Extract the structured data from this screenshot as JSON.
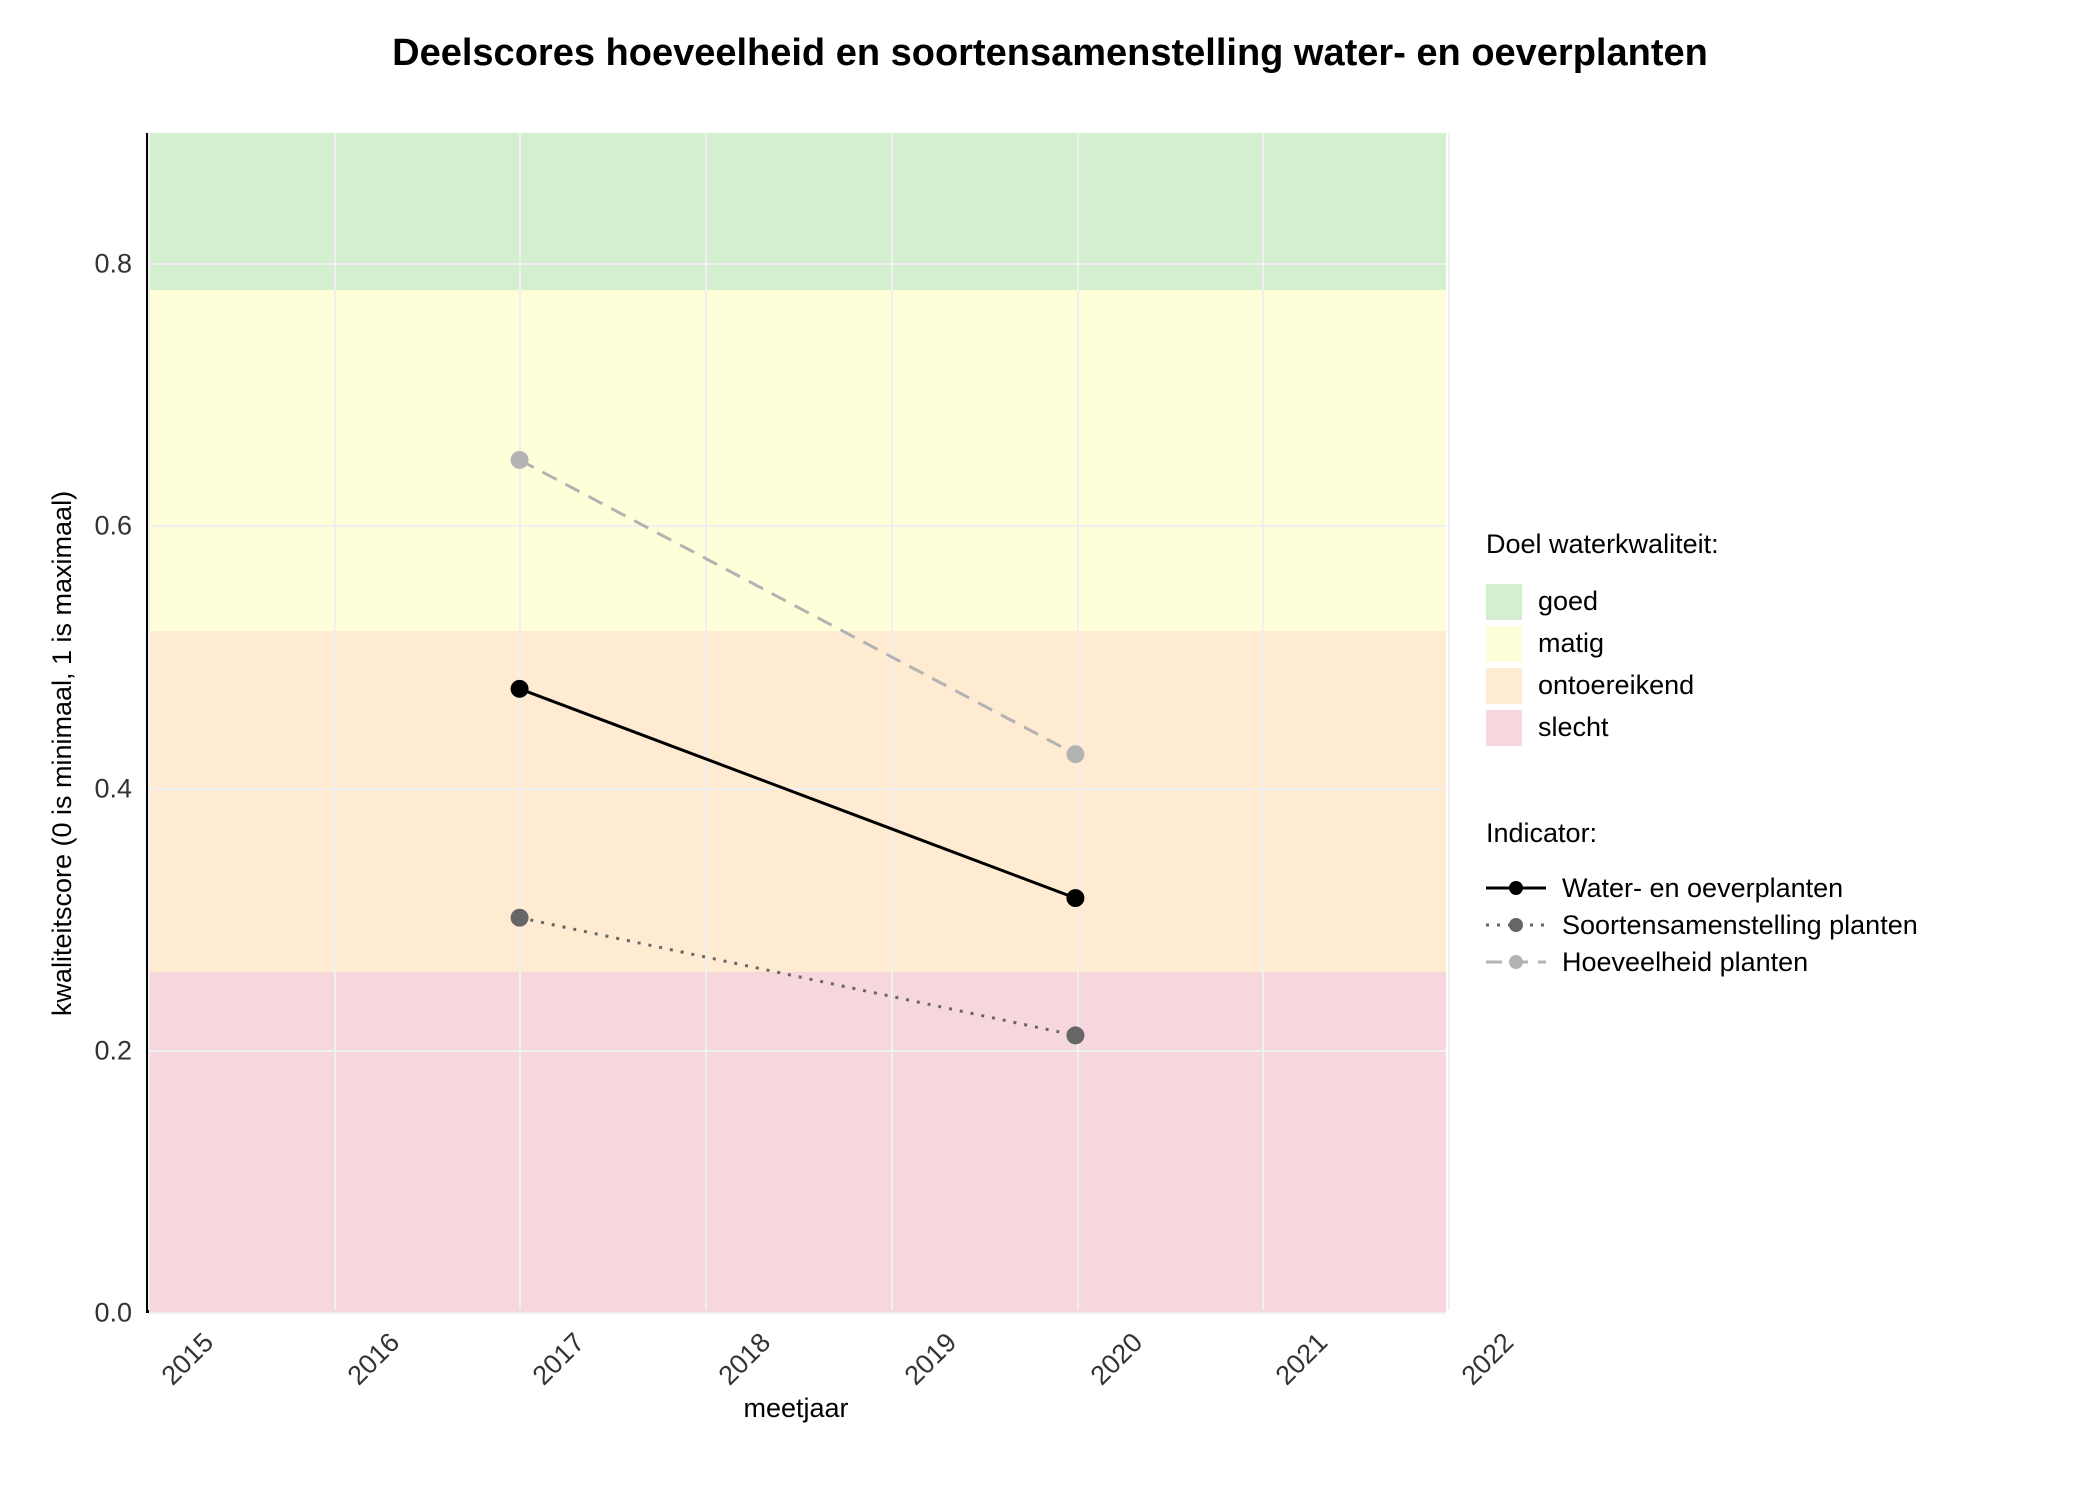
{
  "chart_data": {
    "type": "line",
    "title": "Deelscores hoeveelheid en soortensamenstelling water- en oeverplanten",
    "xlabel": "meetjaar",
    "ylabel": "kwaliteitscore (0 is minimaal, 1 is maximaal)",
    "xlim": [
      2015,
      2022
    ],
    "ylim": [
      0.0,
      0.9
    ],
    "x_ticks": [
      2015,
      2016,
      2017,
      2018,
      2019,
      2020,
      2021,
      2022
    ],
    "y_ticks": [
      0.0,
      0.2,
      0.4,
      0.6,
      0.8
    ],
    "bands": [
      {
        "name": "goed",
        "ymin": 0.78,
        "ymax": 0.9,
        "color": "#d4eed0"
      },
      {
        "name": "matig",
        "ymin": 0.52,
        "ymax": 0.78,
        "color": "#feffd8"
      },
      {
        "name": "ontoereikend",
        "ymin": 0.26,
        "ymax": 0.52,
        "color": "#feebd1"
      },
      {
        "name": "slecht",
        "ymin": 0.0,
        "ymax": 0.26,
        "color": "#f7d7de"
      }
    ],
    "series": [
      {
        "name": "Water- en oeverplanten",
        "color": "#000000",
        "dash": "solid",
        "x": [
          2017,
          2020
        ],
        "values": [
          0.475,
          0.315
        ]
      },
      {
        "name": "Soortensamenstelling planten",
        "color": "#666666",
        "dash": "dotted",
        "x": [
          2017,
          2020
        ],
        "values": [
          0.3,
          0.21
        ]
      },
      {
        "name": "Hoeveelheid planten",
        "color": "#b3b3b3",
        "dash": "dashed",
        "x": [
          2017,
          2020
        ],
        "values": [
          0.65,
          0.425
        ]
      }
    ],
    "legend_band_title": "Doel waterkwaliteit:",
    "legend_series_title": "Indicator:"
  }
}
